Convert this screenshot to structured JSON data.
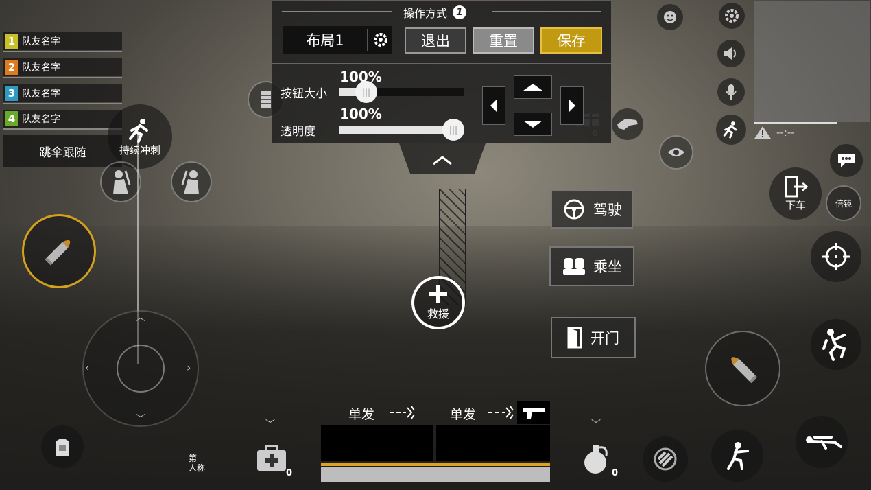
{
  "teammates": [
    {
      "num": "1",
      "name": "队友名字",
      "color": "#c7c02a"
    },
    {
      "num": "2",
      "name": "队友名字",
      "color": "#e07a1e"
    },
    {
      "num": "3",
      "name": "队友名字",
      "color": "#2f9bc3"
    },
    {
      "num": "4",
      "name": "队友名字",
      "color": "#6aaa2a"
    }
  ],
  "parachute_follow": "跳伞跟随",
  "sprint_label": "持续冲刺",
  "panel": {
    "title": "操作方式",
    "badge": "1",
    "layout_name": "布局1",
    "exit": "退出",
    "reset": "重置",
    "save": "保存",
    "size_label": "按钮大小",
    "size_value": "100%",
    "size_level": 0.15,
    "opacity_label": "透明度",
    "opacity_value": "100%",
    "opacity_level": 1.0
  },
  "actions": {
    "drive": "驾驶",
    "ride": "乘坐",
    "door": "开门"
  },
  "rescue": "救援",
  "exit_vehicle": "下车",
  "scope": "倍镜",
  "first_person": "第一\n人称",
  "ammo_count": "0",
  "medkit_count": "0",
  "grenade_count": "0",
  "timer": "--:--",
  "fire_mode_1": "单发",
  "fire_mode_2": "单发",
  "colors": {
    "save_bg": "#c29a12",
    "accent_ring": "#d4a11c"
  }
}
